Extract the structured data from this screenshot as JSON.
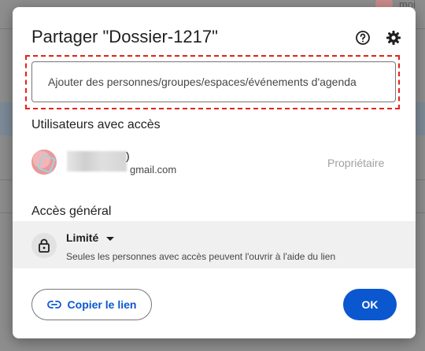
{
  "background": {
    "user_label": "moi"
  },
  "dialog": {
    "title": "Partager \"Dossier-1217\"",
    "add_people_placeholder": "Ajouter des personnes/groupes/espaces/événements d'agenda",
    "users_section_title": "Utilisateurs avec accès",
    "user": {
      "name_suffix": ")",
      "email_suffix": "gmail.com",
      "role": "Propriétaire"
    },
    "general_access_title": "Accès général",
    "general_access": {
      "selected": "Limité",
      "description": "Seules les personnes avec accès peuvent l'ouvrir à l'aide du lien"
    },
    "copy_link_label": "Copier le lien",
    "ok_label": "OK"
  },
  "colors": {
    "accent": "#0b57d0",
    "highlight_border": "#e2231a"
  },
  "icons": [
    "help-icon",
    "gear-icon",
    "lock-icon",
    "dropdown-arrow-icon",
    "link-icon"
  ]
}
